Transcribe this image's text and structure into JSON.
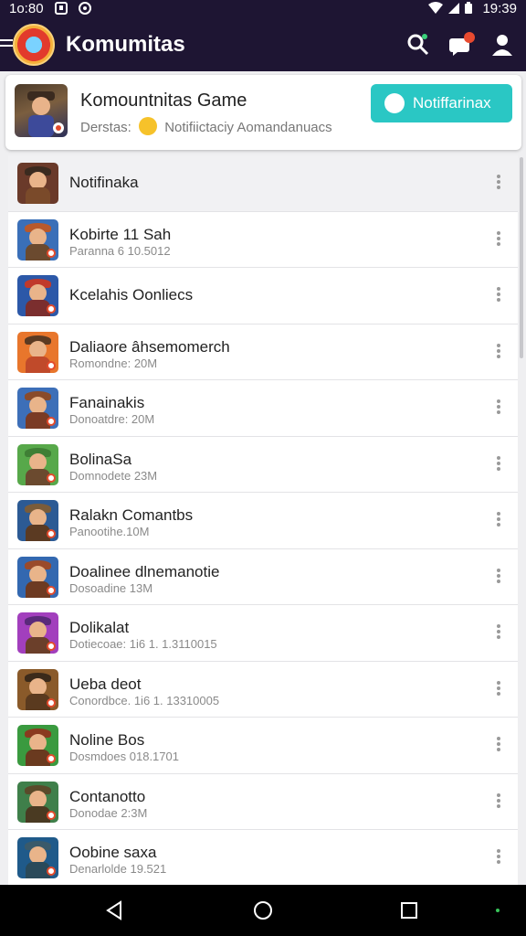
{
  "status_bar": {
    "time_left": "1o:80",
    "time_right": "19:39",
    "battery_level": "19"
  },
  "app_bar": {
    "title": "Komumitas",
    "icons": [
      "menu-icon",
      "app-logo",
      "search-icon",
      "chat-icon",
      "profile-icon"
    ],
    "background": "#1e1533"
  },
  "featured": {
    "title": "Komountnitas Game",
    "subtitle_prefix": "Derstas:",
    "subtitle_text": "Notifiictaciy Aomandanuacs",
    "button_label": "Notiffarinax",
    "button_color": "#2ac7c4"
  },
  "list": {
    "header_label": "Notifinaka",
    "items": [
      {
        "title": "Kobirte 11 Sah",
        "subtitle": "Paranna 6 10.5012",
        "thumb": "#3a6fb8",
        "hat": "#b8592c",
        "body": "#6b4a2f"
      },
      {
        "title": "Kcelahis Oonliecs",
        "subtitle": "",
        "thumb": "#2c58a8",
        "hat": "#c0392b",
        "body": "#7b2e2e"
      },
      {
        "title": "Daliaore âhsemomerch",
        "subtitle": "Romondne: 20M",
        "thumb": "#e8762c",
        "hat": "#5b3a22",
        "body": "#c04a2a"
      },
      {
        "title": "Fanainakis",
        "subtitle": "Donoatdre: 20M",
        "thumb": "#3d6fb8",
        "hat": "#8a4b2a",
        "body": "#7a3b25"
      },
      {
        "title": "BolinaSa",
        "subtitle": "Domnodete 23M",
        "thumb": "#57a84a",
        "hat": "#3f7f35",
        "body": "#6b4a2f"
      },
      {
        "title": "Ralakn Comantbs",
        "subtitle": "Panootihe.10M",
        "thumb": "#2c5a94",
        "hat": "#7a5c3a",
        "body": "#5b3a22"
      },
      {
        "title": "Doalinee dlnemanotie",
        "subtitle": "Dosoadine 13M",
        "thumb": "#3368b0",
        "hat": "#9a4a2a",
        "body": "#6d3a22"
      },
      {
        "title": "Dolikalat",
        "subtitle": "Dotiecoae: 1i6 1. 1.3110015",
        "thumb": "#a23fbd",
        "hat": "#5a2a7a",
        "body": "#6b3f2a"
      },
      {
        "title": "Ueba deot",
        "subtitle": "Conordbce. 1i6 1. 13310005",
        "thumb": "#8a5a2a",
        "hat": "#3b2a1a",
        "body": "#5a3a1f"
      },
      {
        "title": "Noline Bos",
        "subtitle": "Dosmdoes 018.1701",
        "thumb": "#3a9a3f",
        "hat": "#8a3a1f",
        "body": "#6a3a1f"
      },
      {
        "title": "Contanotto",
        "subtitle": "Donodae 2:3M",
        "thumb": "#3f7f4a",
        "hat": "#5a4a2a",
        "body": "#4a3a22"
      },
      {
        "title": "Oobine saxa",
        "subtitle": "Denarlolde 19.521",
        "thumb": "#1f5a8a",
        "hat": "#3a5a6a",
        "body": "#2a4a5a"
      }
    ]
  },
  "nav_bar": {
    "icons": [
      "back-icon",
      "home-icon",
      "recent-apps-icon"
    ]
  }
}
